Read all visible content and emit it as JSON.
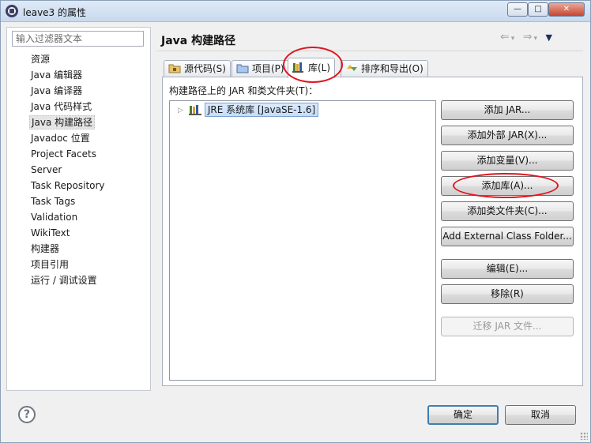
{
  "window": {
    "title": "leave3 的属性"
  },
  "sidebar": {
    "filter_placeholder": "输入过滤器文本",
    "items": [
      {
        "label": "资源"
      },
      {
        "label": "Java 编辑器"
      },
      {
        "label": "Java 编译器"
      },
      {
        "label": "Java 代码样式"
      },
      {
        "label": "Java 构建路径",
        "selected": true
      },
      {
        "label": "Javadoc 位置"
      },
      {
        "label": "Project Facets"
      },
      {
        "label": "Server"
      },
      {
        "label": "Task Repository"
      },
      {
        "label": "Task Tags"
      },
      {
        "label": "Validation"
      },
      {
        "label": "WikiText"
      },
      {
        "label": "构建器"
      },
      {
        "label": "项目引用"
      },
      {
        "label": "运行 / 调试设置"
      }
    ]
  },
  "main": {
    "title": "Java 构建路径",
    "tabs": [
      {
        "label": "源代码(S)",
        "icon": "source-folder-icon"
      },
      {
        "label": "项目(P)",
        "icon": "project-folder-icon"
      },
      {
        "label": "库(L)",
        "icon": "library-icon",
        "active": true
      },
      {
        "label": "排序和导出(O)",
        "icon": "order-export-icon"
      }
    ],
    "panel_label": "构建路径上的 JAR 和类文件夹(T)：",
    "tree": {
      "items": [
        {
          "label": "JRE 系统库 [JavaSE-1.6]",
          "icon": "library-icon",
          "expanded": false
        }
      ]
    },
    "buttons": {
      "add_jar": "添加 JAR...",
      "add_external_jar": "添加外部 JAR(X)...",
      "add_variable": "添加变量(V)...",
      "add_library": "添加库(A)...",
      "add_class_folder": "添加类文件夹(C)...",
      "add_external_class_folder": "Add External Class Folder...",
      "edit": "编辑(E)...",
      "remove": "移除(R)",
      "migrate_jar": "迁移 JAR 文件..."
    }
  },
  "footer": {
    "ok": "确定",
    "cancel": "取消"
  },
  "colors": {
    "highlight_ellipse": "#e0141e",
    "selection_bg": "#c4ddfb",
    "default_button_border": "#3c7fb1"
  }
}
